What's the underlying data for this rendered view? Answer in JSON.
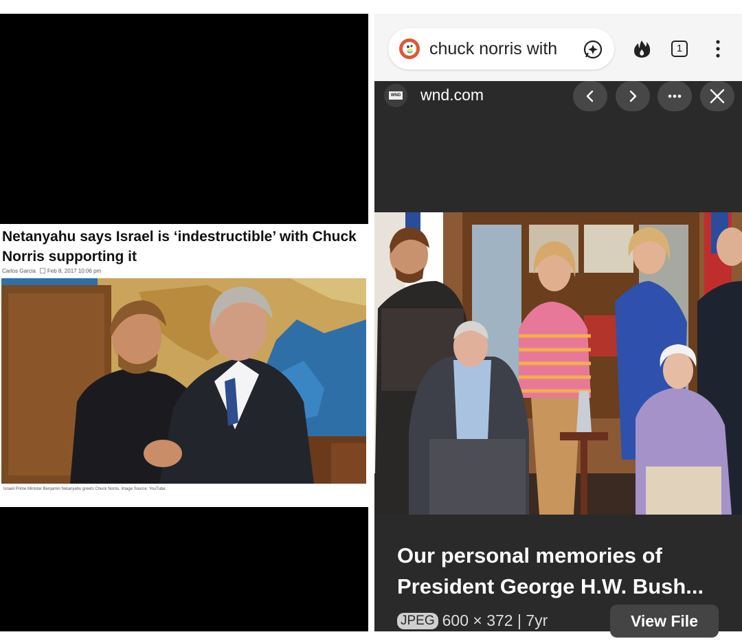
{
  "left_article": {
    "headline": "Netanyahu says Israel is ‘indestructible’ with Chuck Norris supporting it",
    "author": "Carlos Garcia",
    "date": "Feb 8, 2017 10:06 pm",
    "caption": "Israeli Prime Minister Benjamin Netanyahu greets Chuck Norris. Image Source: YouTube."
  },
  "browser": {
    "search_query": "chuck norris with",
    "tab_count": "1",
    "icons": [
      "duckduckgo-logo-icon",
      "ai-chat-icon",
      "fire-icon",
      "tabs-icon",
      "overflow-menu-icon"
    ]
  },
  "image_viewer": {
    "favicon_text": "WND",
    "site": "wnd.com",
    "buttons": [
      "previous-icon",
      "next-icon",
      "more-icon",
      "close-icon"
    ],
    "title": "Our personal memories of President George H.W. Bush...",
    "format": "JPEG",
    "dimensions": "600 × 372",
    "separator": "|",
    "age": "7yr",
    "view_file_label": "View File"
  },
  "colors": {
    "viewer_bg": "#2a2a2a",
    "ddg_orange": "#de5833",
    "button_bg": "#474747"
  }
}
